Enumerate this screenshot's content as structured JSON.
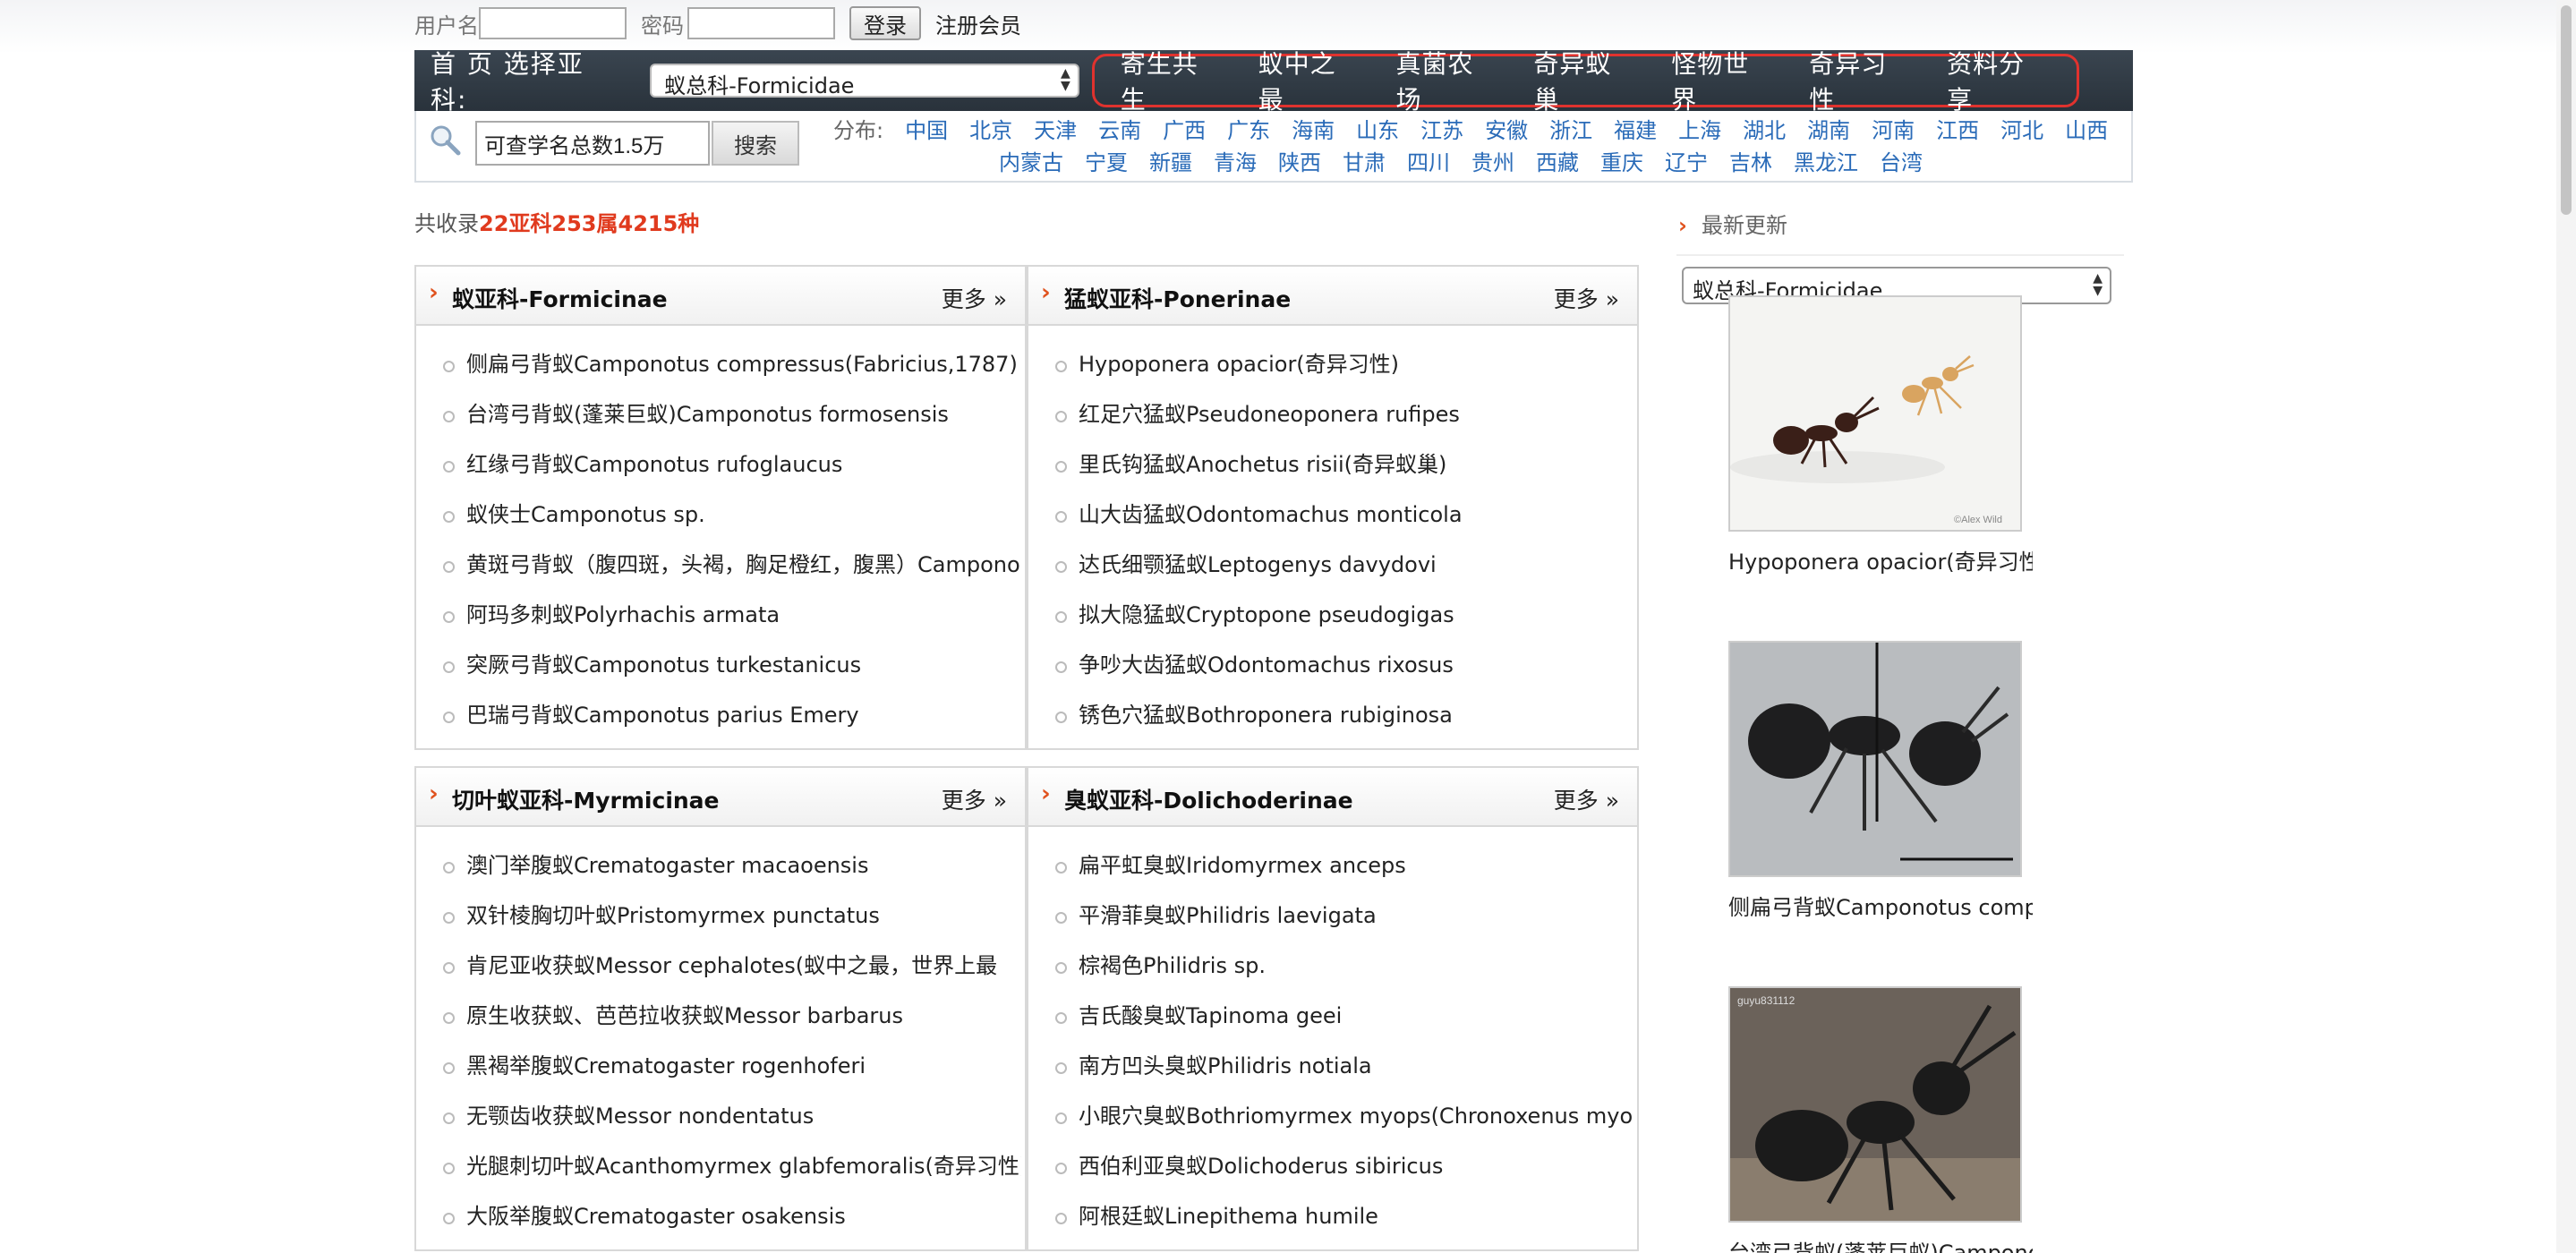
{
  "login": {
    "username_label": "用户名",
    "password_label": "密码",
    "login_button": "登录",
    "register_link": "注册会员"
  },
  "nav": {
    "brand": "首 页 选择亚科:",
    "family_select": "蚁总科-Formicidae",
    "menu": [
      "寄生共生",
      "蚁中之最",
      "真菌农场",
      "奇异蚁巢",
      "怪物世界",
      "奇异习性",
      "资料分享"
    ]
  },
  "search": {
    "input_value": "可查学名总数1.5万",
    "button": "搜索",
    "dist_label": "分布:",
    "provinces_row1": [
      "中国",
      "北京",
      "天津",
      "云南",
      "广西",
      "广东",
      "海南",
      "山东",
      "江苏",
      "安徽",
      "浙江",
      "福建",
      "上海",
      "湖北",
      "湖南",
      "河南",
      "江西",
      "河北",
      "山西"
    ],
    "provinces_row2": [
      "内蒙古",
      "宁夏",
      "新疆",
      "青海",
      "陕西",
      "甘肃",
      "四川",
      "贵州",
      "西藏",
      "重庆",
      "辽宁",
      "吉林",
      "黑龙江",
      "台湾"
    ]
  },
  "count": {
    "prefix": "共收录",
    "value": "22亚科253属4215种"
  },
  "panels": [
    {
      "title": "蚁亚科-Formicinae",
      "more": "更多 »",
      "items": [
        "侧扁弓背蚁Camponotus compressus(Fabricius,1787)",
        "台湾弓背蚁(蓬莱巨蚁)Camponotus formosensis",
        "红缘弓背蚁Camponotus rufoglaucus",
        "蚁侠士Camponotus sp.",
        "黄斑弓背蚁（腹四斑，头褐，胸足橙红，腹黑）Campono",
        "阿玛多刺蚁Polyrhachis armata",
        "突厥弓背蚁Camponotus turkestanicus",
        "巴瑞弓背蚁Camponotus parius Emery"
      ]
    },
    {
      "title": "猛蚁亚科-Ponerinae",
      "more": "更多 »",
      "items": [
        "Hypoponera opacior(奇异习性)",
        "红足穴猛蚁Pseudoneoponera rufipes",
        "里氏钩猛蚁Anochetus risii(奇异蚁巢)",
        "山大齿猛蚁Odontomachus monticola",
        "达氏细颚猛蚁Leptogenys davydovi",
        "拟大隐猛蚁Cryptopone pseudogigas",
        "争吵大齿猛蚁Odontomachus rixosus",
        "锈色穴猛蚁Bothroponera rubiginosa"
      ]
    },
    {
      "title": "切叶蚁亚科-Myrmicinae",
      "more": "更多 »",
      "items": [
        "澳门举腹蚁Crematogaster macaoensis",
        "双针棱胸切叶蚁Pristomyrmex punctatus",
        "肯尼亚收获蚁Messor cephalotes(蚁中之最，世界上最",
        "原生收获蚁、芭芭拉收获蚁Messor barbarus",
        "黑褐举腹蚁Crematogaster rogenhoferi",
        "无颚齿收获蚁Messor nondentatus",
        "光腿刺切叶蚁Acanthomyrmex glabfemoralis(奇异习性)",
        "大阪举腹蚁Crematogaster osakensis"
      ]
    },
    {
      "title": "臭蚁亚科-Dolichoderinae",
      "more": "更多 »",
      "items": [
        "扁平虹臭蚁Iridomyrmex anceps",
        "平滑菲臭蚁Philidris laevigata",
        "棕褐色Philidris sp.",
        "吉氏酸臭蚁Tapinoma geei",
        "南方凹头臭蚁Philidris notiala",
        "小眼穴臭蚁Bothriomyrmex myops(Chronoxenus myops)",
        "西伯利亚臭蚁Dolichoderus sibiricus",
        "阿根廷蚁Linepithema humile"
      ]
    }
  ],
  "sidebar": {
    "heading": "最新更新",
    "select": "蚁总科-Formicidae",
    "thumbs": [
      {
        "caption": "Hypoponera opacior(奇异习性)",
        "watermark": "©Alex Wild"
      },
      {
        "caption": "侧扁弓背蚁Camponotus compr"
      },
      {
        "caption": "台湾弓背蚁(蓬莱巨蚁)Campono",
        "watermark": "guyu831112"
      }
    ]
  },
  "colors": {
    "accent": "#e03a1e",
    "link": "#2a6bb8",
    "nav_bg": "#2f3942",
    "menu_outline": "#e0322e"
  }
}
